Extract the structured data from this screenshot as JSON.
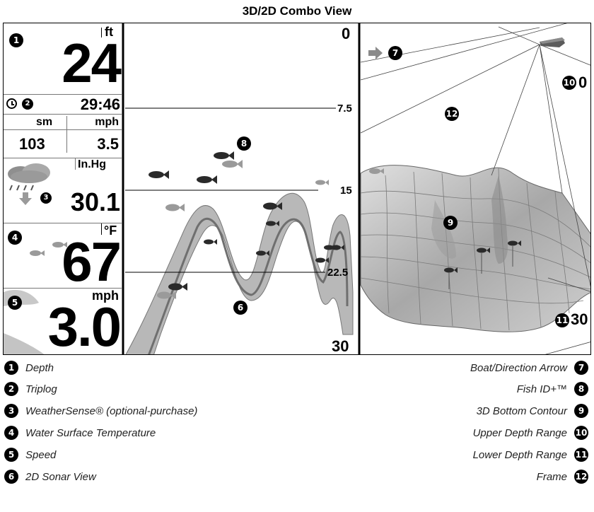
{
  "title": "3D/2D Combo View",
  "readouts": {
    "depth_unit": "ft",
    "depth_value": "24",
    "triplog_time": "29:46",
    "distance_unit": "sm",
    "speed_unit_1": "mph",
    "distance_value": "103",
    "speed_value_1": "3.5",
    "pressure_unit": "In.Hg",
    "pressure_value": "30.1",
    "temp_unit": "°F",
    "temp_value": "67",
    "speed_unit_2": "mph",
    "speed_value_2": "3.0"
  },
  "sonar": {
    "scale_top": "0",
    "scale_1": "7.5",
    "scale_2": "15",
    "scale_3": "22.5",
    "scale_bottom": "30"
  },
  "view3d": {
    "upper_range": "0",
    "lower_range": "30"
  },
  "callouts": {
    "c1": "1",
    "c2": "2",
    "c3": "3",
    "c4": "4",
    "c5": "5",
    "c6": "6",
    "c7": "7",
    "c8": "8",
    "c9": "9",
    "c10": "10",
    "c11": "11",
    "c12": "12"
  },
  "legend_left": [
    {
      "num": "1",
      "label": "Depth"
    },
    {
      "num": "2",
      "label": "Triplog"
    },
    {
      "num": "3",
      "label": "WeatherSense® (optional-purchase)"
    },
    {
      "num": "4",
      "label": "Water Surface Temperature"
    },
    {
      "num": "5",
      "label": "Speed"
    },
    {
      "num": "6",
      "label": "2D Sonar View"
    }
  ],
  "legend_right": [
    {
      "num": "7",
      "label": "Boat/Direction Arrow"
    },
    {
      "num": "8",
      "label": "Fish ID+™"
    },
    {
      "num": "9",
      "label": "3D Bottom Contour"
    },
    {
      "num": "10",
      "label": "Upper Depth Range"
    },
    {
      "num": "11",
      "label": "Lower Depth Range"
    },
    {
      "num": "12",
      "label": "Frame"
    }
  ],
  "colors": {
    "sonar_band": "#b8b8b8",
    "sonar_core": "#6f6f6f",
    "terrain_light": "#d6d6d6",
    "terrain_dark": "#8c8c8c",
    "fish_dark": "#2a2a2a",
    "fish_light": "#9a9a9a"
  }
}
